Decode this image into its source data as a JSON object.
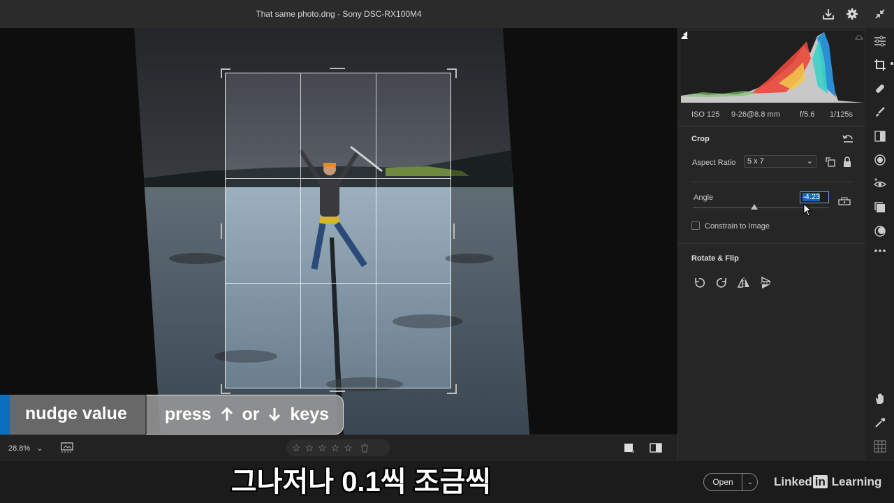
{
  "window": {
    "title": "That same photo.dng  -  Sony DSC-RX100M4"
  },
  "histogram": {
    "exif": {
      "iso": "ISO 125",
      "focal": "9-26@8.8 mm",
      "aperture": "f/5.6",
      "shutter": "1/125s"
    }
  },
  "crop_panel": {
    "title": "Crop",
    "aspect_ratio_label": "Aspect Ratio",
    "aspect_ratio_value": "5 x 7",
    "angle_label": "Angle",
    "angle_value": "-4.23",
    "angle_slider_fraction": 0.45,
    "constrain_label": "Constrain to Image",
    "constrain_checked": false
  },
  "rotate_flip": {
    "title": "Rotate & Flip"
  },
  "bottom_bar": {
    "zoom": "28.8%",
    "star_glyph": "☆",
    "rating": 0
  },
  "footer": {
    "open_label": "Open",
    "brand_pre": "Linked",
    "brand_in": "in",
    "brand_post": " Learning"
  },
  "overlay_tip": {
    "label": "nudge value",
    "press": "press",
    "or": "or",
    "keys": "keys"
  },
  "subtitle": "그나저나 0.1씩 조금씩",
  "colors": {
    "accent": "#0a6fbf",
    "selection": "#1565c0"
  }
}
